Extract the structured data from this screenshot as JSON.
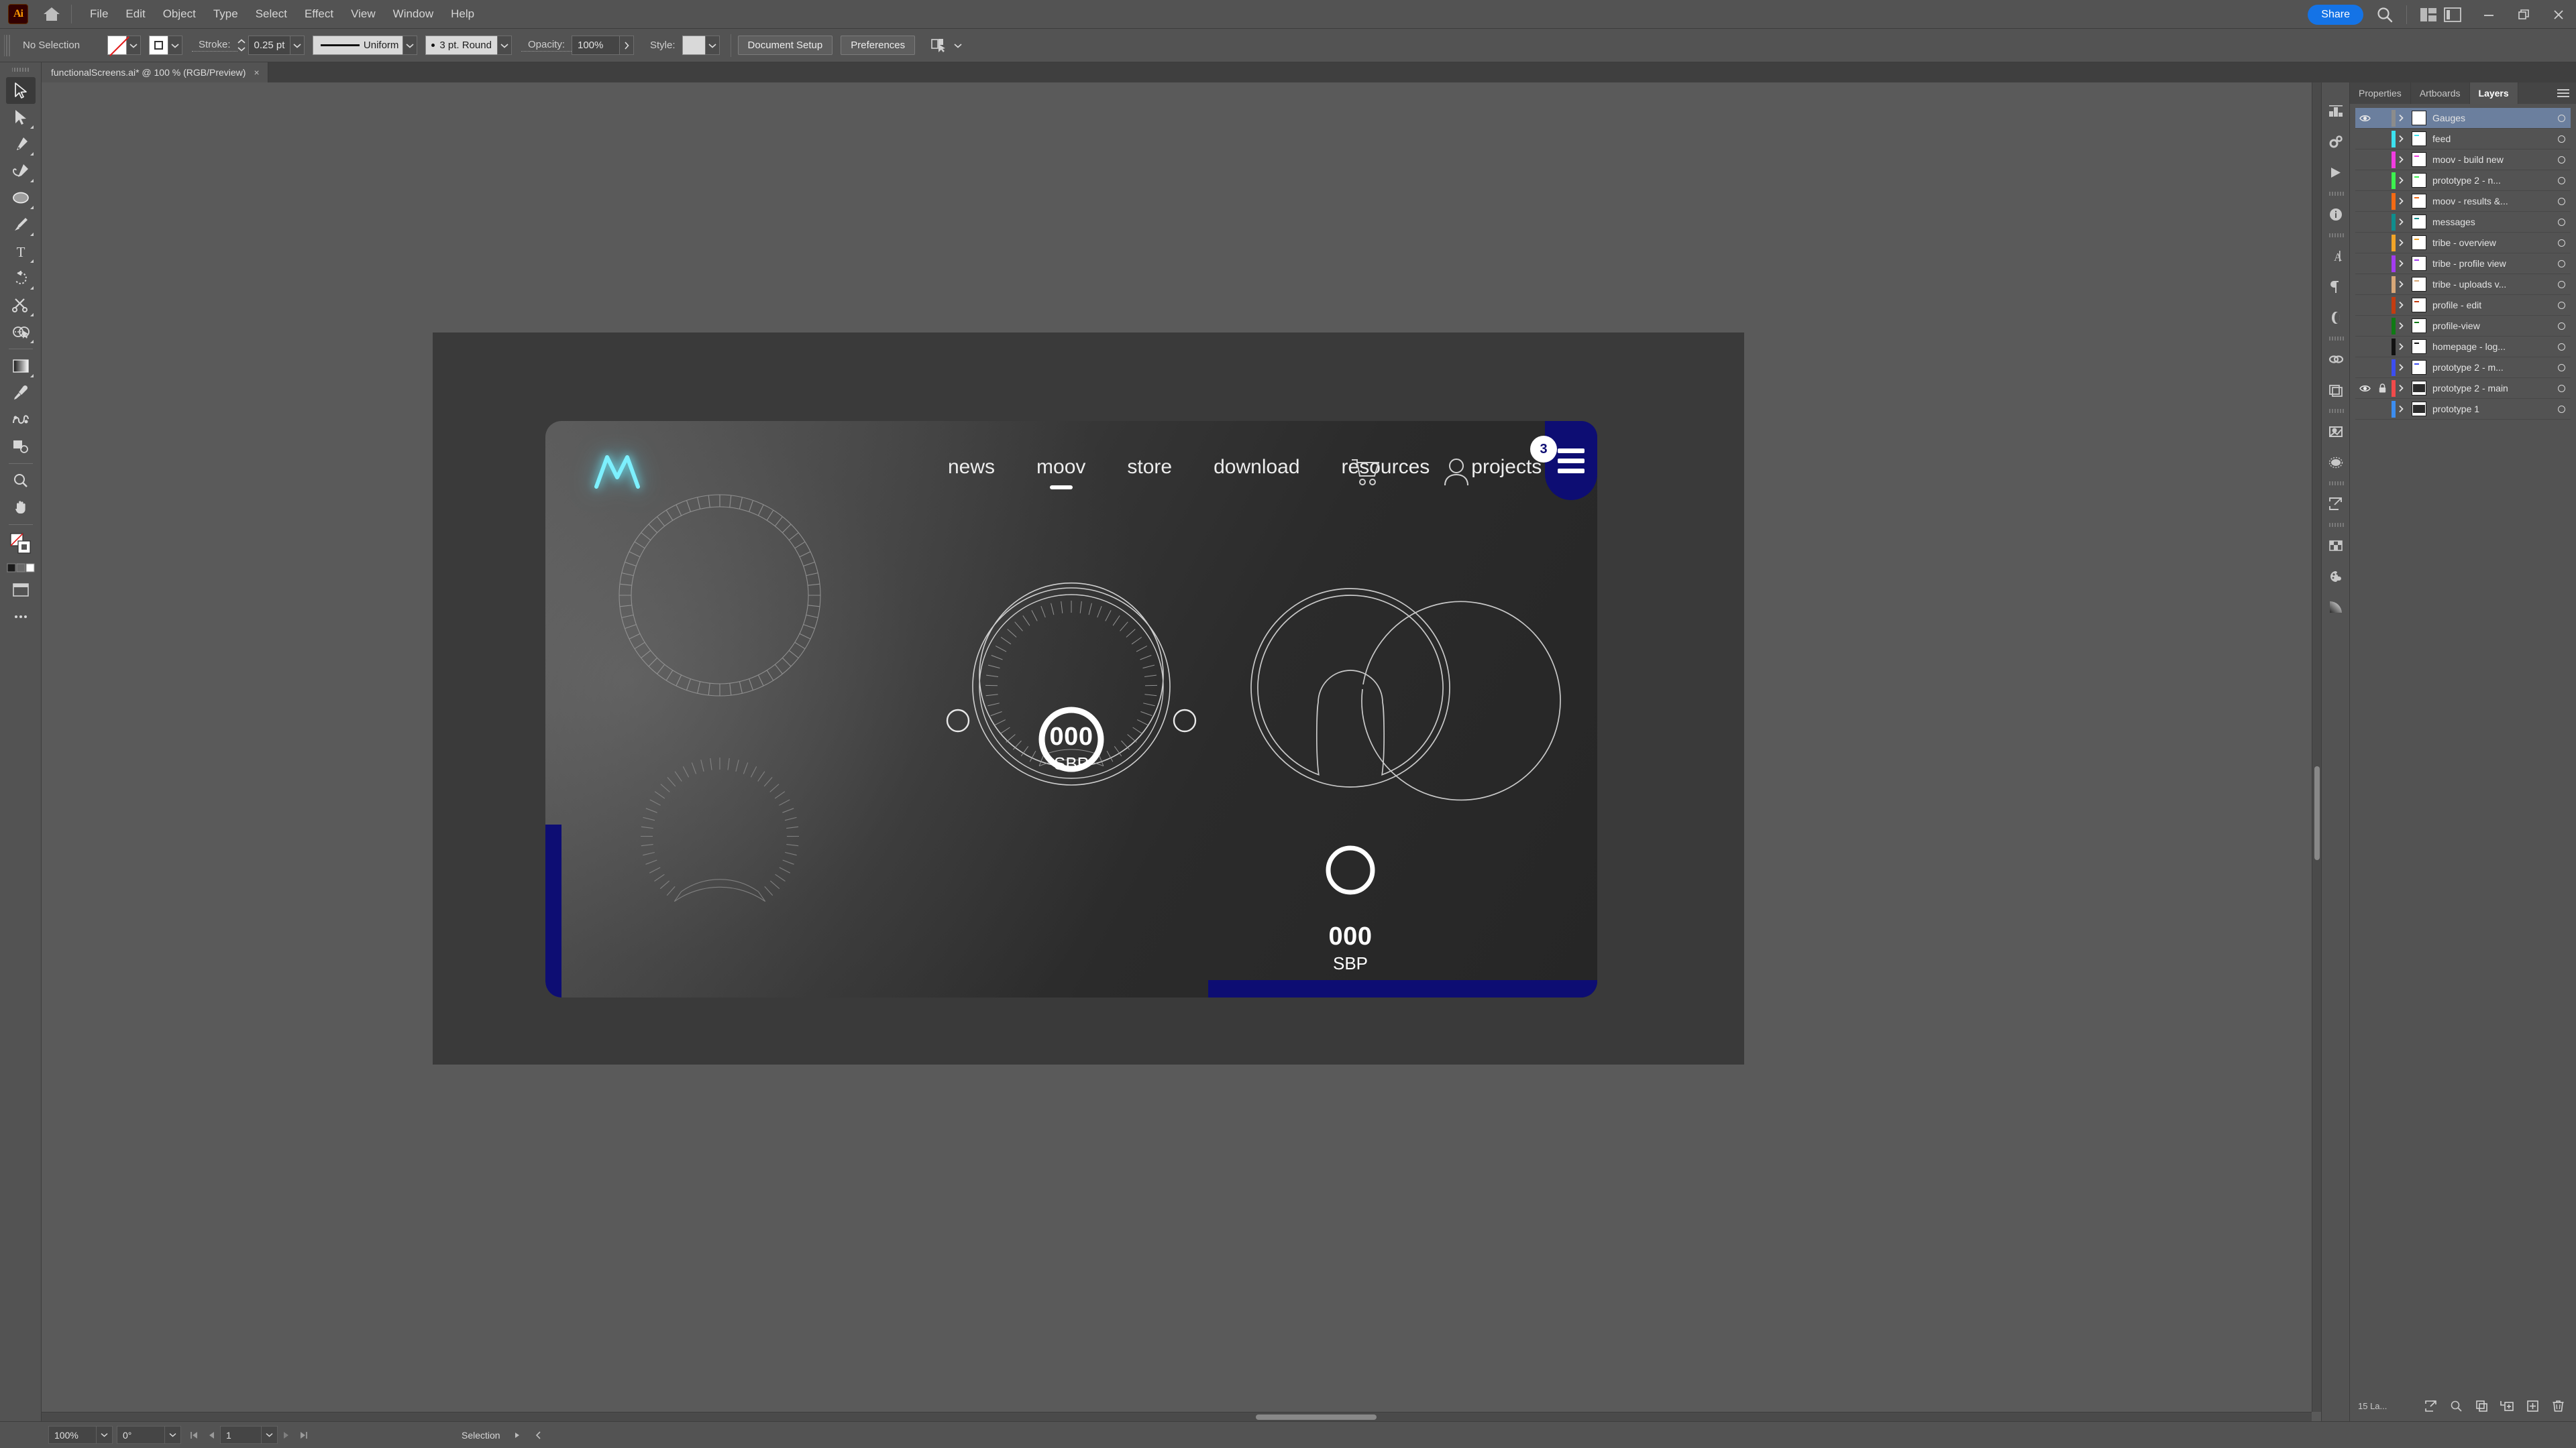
{
  "app": {
    "logo_text": "Ai",
    "home_icon": "home-icon"
  },
  "menubar": {
    "items": [
      "File",
      "Edit",
      "Object",
      "Type",
      "Select",
      "Effect",
      "View",
      "Window",
      "Help"
    ],
    "share_label": "Share",
    "search_icon": "search-icon",
    "arrange_icon": "arrange-documents-icon",
    "workspace_icon": "workspace-switcher-icon",
    "minimize_icon": "minimize-icon",
    "restore_icon": "restore-icon",
    "close_icon": "close-icon"
  },
  "controlbar": {
    "selection_status": "No Selection",
    "fill_label": "fill-none-swatch",
    "stroke_swatch_label": "stroke-swatch",
    "stroke_label": "Stroke:",
    "stroke_weight": "0.25 pt",
    "profile_label": "Uniform",
    "brush_label": "3 pt. Round",
    "opacity_label": "Opacity:",
    "opacity_value": "100%",
    "style_label": "Style:",
    "document_setup_label": "Document Setup",
    "preferences_label": "Preferences",
    "select_similar_icon": "select-similar-objects-icon"
  },
  "tabs": {
    "document_title": "functionalScreens.ai* @ 100 % (RGB/Preview)",
    "close_glyph": "×"
  },
  "toolbar": {
    "tools": [
      {
        "name": "selection-tool",
        "active": true
      },
      {
        "name": "direct-selection-tool",
        "active": false
      },
      {
        "name": "pen-tool",
        "active": false
      },
      {
        "name": "curvature-tool",
        "active": false
      },
      {
        "name": "ellipse-tool",
        "active": false
      },
      {
        "name": "paintbrush-tool",
        "active": false
      },
      {
        "name": "type-tool",
        "active": false
      },
      {
        "name": "rotate-tool",
        "active": false
      },
      {
        "name": "scissors-tool",
        "active": false
      },
      {
        "name": "shape-builder-tool",
        "active": false
      },
      {
        "name": "gradient-tool",
        "active": false
      },
      {
        "name": "eyedropper-tool",
        "active": false
      },
      {
        "name": "blend-tool",
        "active": false
      },
      {
        "name": "artboard-tool",
        "active": false
      },
      {
        "name": "zoom-tool",
        "active": false
      },
      {
        "name": "hand-tool",
        "active": false
      },
      {
        "name": "fill-stroke-swatch",
        "active": false
      },
      {
        "name": "color-modes",
        "active": false
      },
      {
        "name": "screen-mode-tool",
        "active": false
      },
      {
        "name": "more-tools",
        "active": false
      }
    ]
  },
  "rail": {
    "icons": [
      "properties-panel-icon",
      "actions-panel-icon",
      "play-icon",
      "info-panel-icon",
      "character-panel-icon",
      "paragraph-panel-icon",
      "opacity-panel-icon",
      "links-panel-icon",
      "artboards-panel-icon",
      "image-trace-panel-icon",
      "transparency-panel-icon",
      "export-panel-icon",
      "swatches-panel-icon",
      "color-guide-panel-icon",
      "gradient-panel-icon"
    ]
  },
  "panel": {
    "tabs": [
      {
        "label": "Properties",
        "active": false
      },
      {
        "label": "Artboards",
        "active": false
      },
      {
        "label": "Layers",
        "active": true
      }
    ],
    "menu_icon": "panel-menu-icon",
    "layers": [
      {
        "name": "Gauges",
        "color": "#8c8c8c",
        "visible": true,
        "locked": false,
        "selected": true
      },
      {
        "name": "feed",
        "color": "#3ce2ef",
        "visible": false,
        "locked": false,
        "selected": false
      },
      {
        "name": "moov - build new",
        "color": "#f13ce0",
        "visible": false,
        "locked": false,
        "selected": false
      },
      {
        "name": "prototype 2 - n...",
        "color": "#3cf14e",
        "visible": false,
        "locked": false,
        "selected": false
      },
      {
        "name": "moov - results &...",
        "color": "#f26a14",
        "visible": false,
        "locked": false,
        "selected": false
      },
      {
        "name": "messages",
        "color": "#0f8d8d",
        "visible": false,
        "locked": false,
        "selected": false
      },
      {
        "name": "tribe - overview",
        "color": "#f0a428",
        "visible": false,
        "locked": false,
        "selected": false
      },
      {
        "name": "tribe - profile view",
        "color": "#a33cf0",
        "visible": false,
        "locked": false,
        "selected": false
      },
      {
        "name": "tribe - uploads v...",
        "color": "#d8a878",
        "visible": false,
        "locked": false,
        "selected": false
      },
      {
        "name": "profile - edit",
        "color": "#c33c10",
        "visible": false,
        "locked": false,
        "selected": false
      },
      {
        "name": "profile-view",
        "color": "#0f7a14",
        "visible": false,
        "locked": false,
        "selected": false
      },
      {
        "name": "homepage - log...",
        "color": "#111111",
        "visible": false,
        "locked": false,
        "selected": false
      },
      {
        "name": "prototype 2 - m...",
        "color": "#3c4ef0",
        "visible": false,
        "locked": false,
        "selected": false
      },
      {
        "name": "prototype 2 - main",
        "color": "#f04a4a",
        "visible": true,
        "locked": true,
        "selected": false
      },
      {
        "name": "prototype 1",
        "color": "#3c8df0",
        "visible": false,
        "locked": false,
        "selected": false
      }
    ],
    "footer": {
      "count_label": "15 La...",
      "icons": [
        "locate-object-icon",
        "search-layers-icon",
        "duplicate-layer-icon",
        "new-sublayer-icon",
        "new-layer-icon",
        "delete-layer-icon"
      ]
    }
  },
  "statusbar": {
    "zoom": "100%",
    "rotation": "0°",
    "artboard_number": "1",
    "tool_status": "Selection",
    "first_icon": "first-artboard-icon",
    "prev_icon": "previous-artboard-icon",
    "next_icon": "next-artboard-icon",
    "last_icon": "last-artboard-icon",
    "status_menu_icon": "status-menu-icon",
    "scroll_left_icon": "scroll-left-icon"
  },
  "artboard": {
    "background": "#3a3a3a",
    "screen": {
      "logo_name": "moov-logo-icon",
      "nav_links": [
        {
          "label": "news",
          "active": false
        },
        {
          "label": "moov",
          "active": true
        },
        {
          "label": "store",
          "active": false
        },
        {
          "label": "download",
          "active": false
        },
        {
          "label": "resources",
          "active": false
        },
        {
          "label": "projects",
          "active": false
        }
      ],
      "cart_icon": "shopping-cart-icon",
      "account_icon": "user-account-icon",
      "cart_badge": "3",
      "menu_icon": "hamburger-menu-icon",
      "accent_color": "#0d0d73",
      "gauges": [
        {
          "name": "gauge-tick-ring-full"
        },
        {
          "name": "gauge-tick-arc-partial"
        },
        {
          "name": "gauge-center-dial"
        },
        {
          "name": "gauge-notched-ring"
        },
        {
          "name": "gauge-small-circle"
        }
      ],
      "readouts": [
        {
          "name": "center-readout",
          "value": "000",
          "unit": "SBP"
        },
        {
          "name": "right-readout",
          "value": "000",
          "unit": "SBP"
        }
      ]
    }
  }
}
